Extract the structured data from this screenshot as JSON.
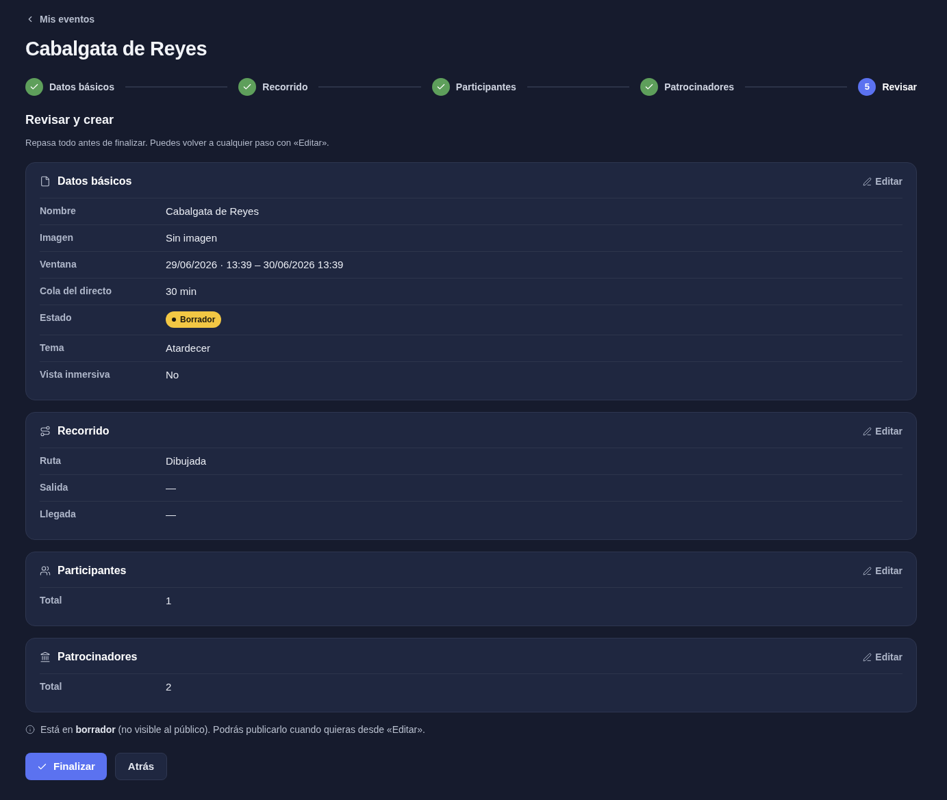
{
  "breadcrumb": {
    "label": "Mis eventos"
  },
  "title": "Cabalgata de Reyes",
  "steps": [
    {
      "label": "Datos básicos",
      "completed": true,
      "selected": false
    },
    {
      "label": "Recorrido",
      "completed": true,
      "selected": false
    },
    {
      "label": "Participantes",
      "completed": true,
      "selected": false
    },
    {
      "label": "Patrocinadores",
      "completed": true,
      "selected": false
    },
    {
      "label": "Revisar",
      "completed": false,
      "selected": true,
      "number": "5"
    }
  ],
  "section_heading": "Revisar y crear",
  "section_subtitle": "Repasa todo antes de finalizar. Puedes volver a cualquier paso con «Editar».",
  "sections": [
    {
      "title": "Datos básicos",
      "edit_label": "Editar",
      "rows": [
        {
          "label": "Nombre",
          "value": "Cabalgata de Reyes",
          "kind": "text"
        },
        {
          "label": "Imagen",
          "value": "Sin imagen",
          "kind": "text"
        },
        {
          "label": "Ventana",
          "value": "29/06/2026 · 13:39 – 30/06/2026 13:39",
          "kind": "text"
        },
        {
          "label": "Cola del directo",
          "value": "30 min",
          "kind": "text"
        },
        {
          "label": "Estado",
          "value": "Borrador",
          "kind": "badge",
          "color": "#f2c744"
        },
        {
          "label": "Tema",
          "value": "Atardecer",
          "kind": "text"
        },
        {
          "label": "Vista inmersiva",
          "value": "No",
          "kind": "text"
        }
      ]
    },
    {
      "title": "Recorrido",
      "edit_label": "Editar",
      "rows": [
        {
          "label": "Ruta",
          "value": "Dibujada",
          "kind": "text"
        },
        {
          "label": "Salida",
          "value": "—",
          "kind": "text"
        },
        {
          "label": "Llegada",
          "value": "—",
          "kind": "text"
        }
      ]
    },
    {
      "title": "Participantes",
      "edit_label": "Editar",
      "rows": [
        {
          "label": "Total",
          "value": "1",
          "kind": "text"
        }
      ]
    },
    {
      "title": "Patrocinadores",
      "edit_label": "Editar",
      "rows": [
        {
          "label": "Total",
          "value": "2",
          "kind": "text"
        }
      ]
    }
  ],
  "note": "Está en **borrador** (no visible al público). Podrás publicarlo cuando quieras desde «Editar».",
  "buttons": [
    {
      "label": "Finalizar",
      "kind": "primary"
    },
    {
      "label": "Atrás",
      "kind": "secondary"
    }
  ]
}
